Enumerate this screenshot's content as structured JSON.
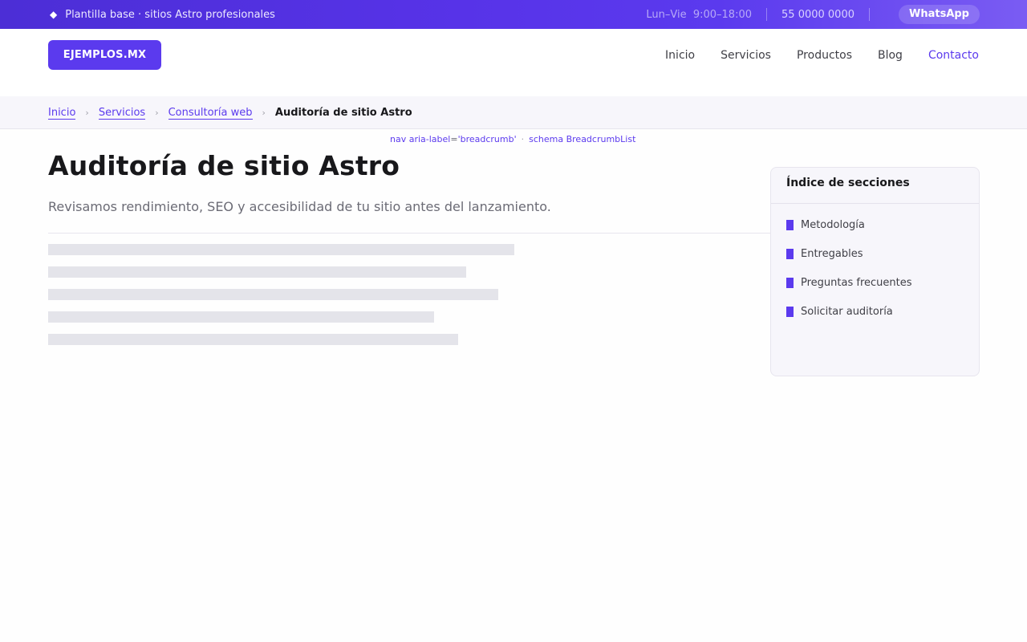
{
  "colors": {
    "accent": "#5b3aee",
    "topbar_gradient_start": "#4c2ed6",
    "topbar_gradient_end": "#7a5cf3",
    "skeleton": "#e4e4ea"
  },
  "topbar": {
    "icon": "diamond-icon",
    "tagline": "Plantilla base · sitios Astro profesionales",
    "hours_days": "Lun–Vie",
    "hours_time": "9:00–18:00",
    "phone": "55 0000 0000",
    "whatsapp_label": "WhatsApp"
  },
  "header": {
    "logo": "EJEMPLOS.MX",
    "nav": [
      "Inicio",
      "Servicios",
      "Productos",
      "Blog",
      "Contacto"
    ],
    "nav_active": "Contacto"
  },
  "breadcrumb": {
    "items": [
      "Inicio",
      "Servicios",
      "Consultoría web"
    ],
    "current": "Auditoría de sitio Astro",
    "separator": "›"
  },
  "annotation": {
    "attr_name": "nav aria-label",
    "equals": "=",
    "attr_value": "'breadcrumb'",
    "separator": "·",
    "schema": "schema BreadcrumbList"
  },
  "main": {
    "title": "Auditoría de sitio Astro",
    "subtitle": "Revisamos rendimiento, SEO y accesibilidad de tu sitio antes del lanzamiento."
  },
  "toc": {
    "title": "Índice de secciones",
    "items": [
      "Metodología",
      "Entregables",
      "Preguntas frecuentes",
      "Solicitar auditoría"
    ]
  }
}
